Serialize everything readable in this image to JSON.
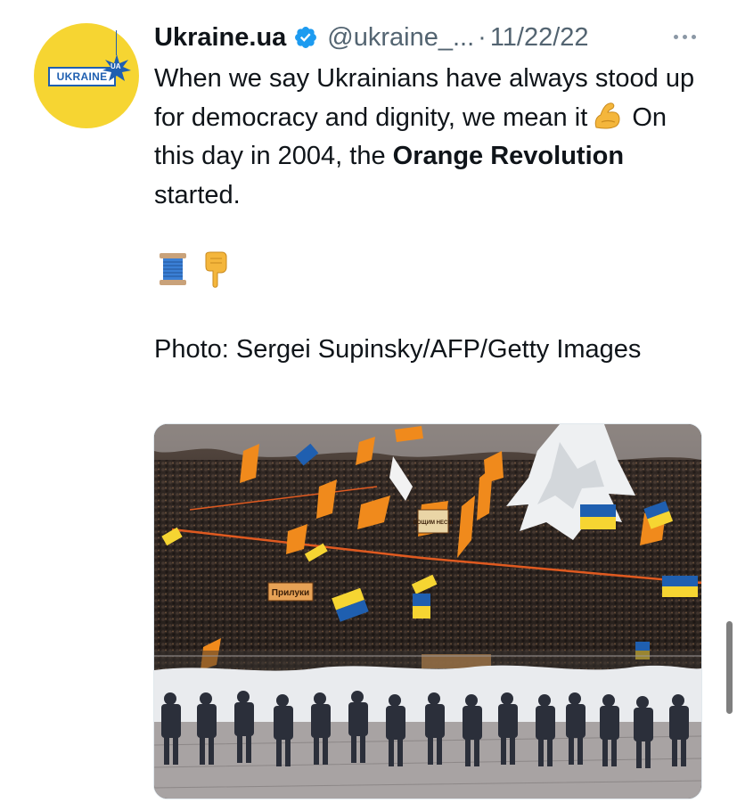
{
  "tweet": {
    "avatar": {
      "logo_text": "UKRAINE",
      "logo_suffix": "UA",
      "background_color": "#f6d532"
    },
    "display_name": "Ukraine.ua",
    "verified_icon": "verified-badge-icon",
    "handle": "@ukraine_...",
    "separator": "·",
    "timestamp": "11/22/22",
    "more_icon": "more-horizontal-icon",
    "text": {
      "part1": "When we say Ukrainians have always stood up for democracy and dignity, we mean it",
      "emoji_flexed_biceps": "flexed-biceps-emoji",
      "part2": "On this day in 2004, the",
      "bold": "Orange Revolution",
      "part3": "started."
    },
    "emoji_row": [
      "thread-spool-emoji",
      "pointing-down-emoji"
    ],
    "caption": "Photo: Sergei Supinsky/AFP/Getty Images",
    "photo": {
      "description_icon": "photo-orange-revolution-crowd",
      "sign_texts": [
        "Прилуки",
        "ВОЩИМ НЕСВІ"
      ]
    }
  },
  "colors": {
    "text": "#0f1419",
    "secondary_text": "#536471",
    "verified_blue": "#1d9bf0",
    "avatar_yellow": "#f6d532",
    "ukraine_blue": "#1f5fb0",
    "orange": "#f08a1c"
  }
}
